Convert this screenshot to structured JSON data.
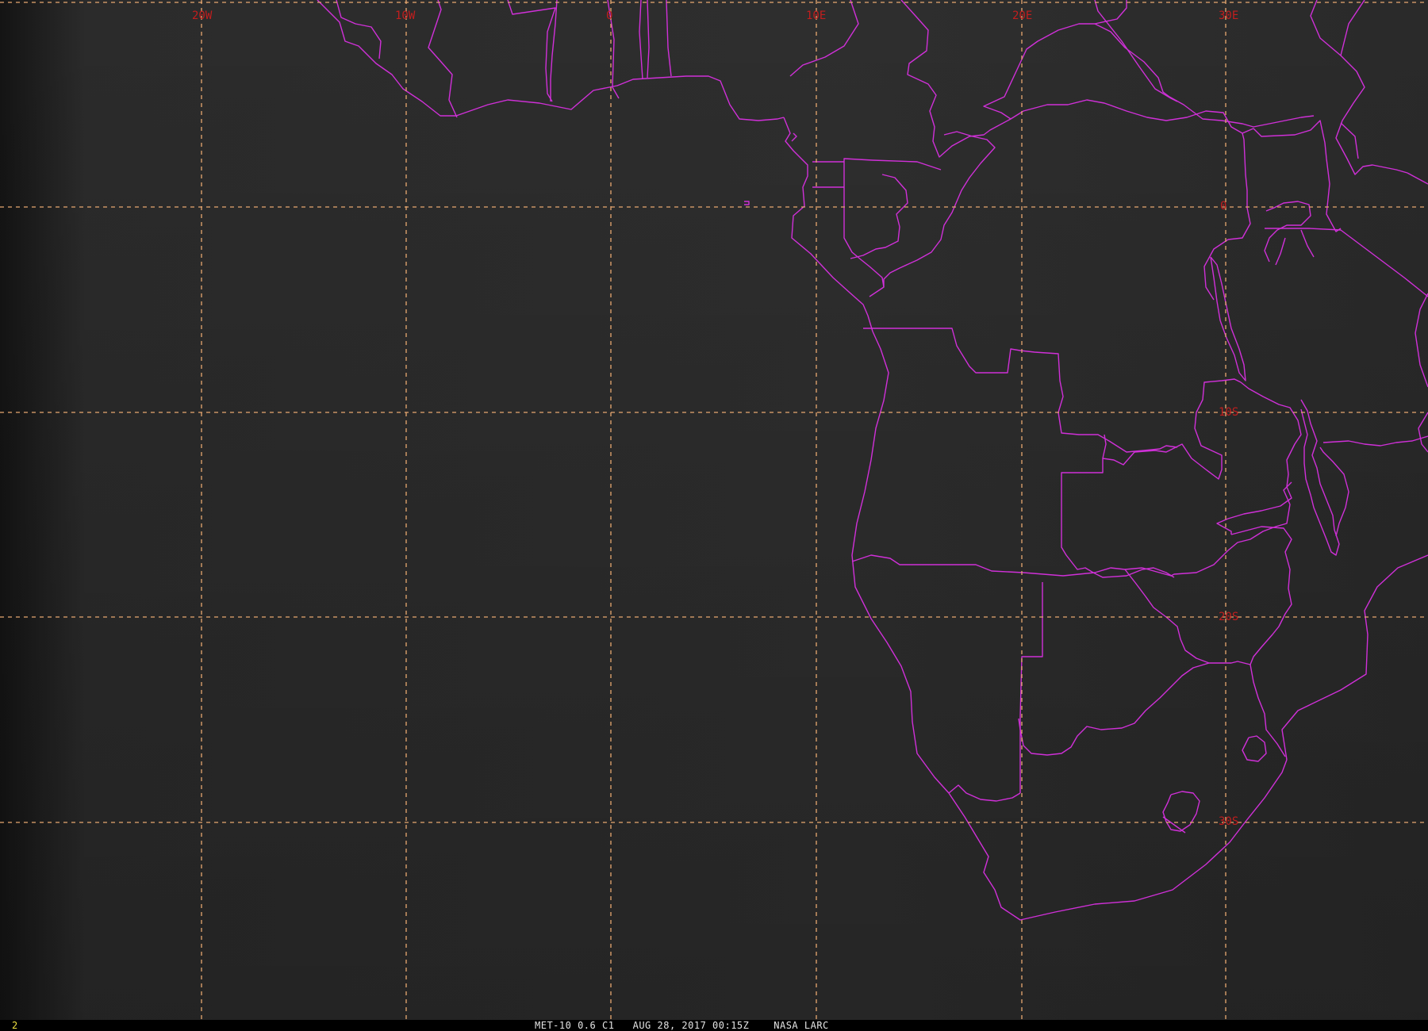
{
  "colors": {
    "coastline": "#d030d8",
    "grid": "#e8a870",
    "grid_label": "#c21e1e",
    "frame_number": "#f0e040",
    "caption": "#e4e4e4"
  },
  "grid": {
    "longitude_labels": [
      "20W",
      "10W",
      "0",
      "10E",
      "20E",
      "30E"
    ],
    "latitude_labels": [
      "0",
      "10S",
      "20S",
      "30S"
    ]
  },
  "status_bar": {
    "frame_number": "2",
    "caption": "MET-10 0.6 C1   AUG 28, 2017 00:15Z    NASA LARC"
  }
}
